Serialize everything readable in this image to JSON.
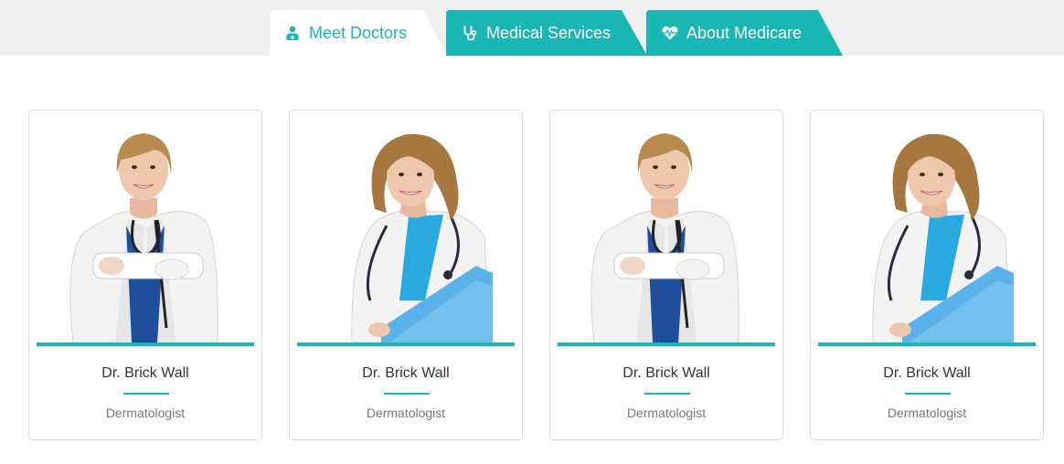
{
  "colors": {
    "accent": "#19b6b4",
    "tab_bar_bg": "#efefef"
  },
  "tabs": [
    {
      "label": "Meet Doctors",
      "icon": "user-md-icon",
      "active": true
    },
    {
      "label": "Medical Services",
      "icon": "stethoscope-icon",
      "active": false
    },
    {
      "label": "About Medicare",
      "icon": "heartbeat-icon",
      "active": false
    }
  ],
  "doctors": [
    {
      "name": "Dr. Brick Wall",
      "specialty": "Dermatologist",
      "photo": "doctor-arms-crossed-photo"
    },
    {
      "name": "Dr. Brick Wall",
      "specialty": "Dermatologist",
      "photo": "doctor-with-folder-photo"
    },
    {
      "name": "Dr. Brick Wall",
      "specialty": "Dermatologist",
      "photo": "doctor-arms-crossed-photo"
    },
    {
      "name": "Dr. Brick Wall",
      "specialty": "Dermatologist",
      "photo": "doctor-with-folder-photo"
    }
  ]
}
